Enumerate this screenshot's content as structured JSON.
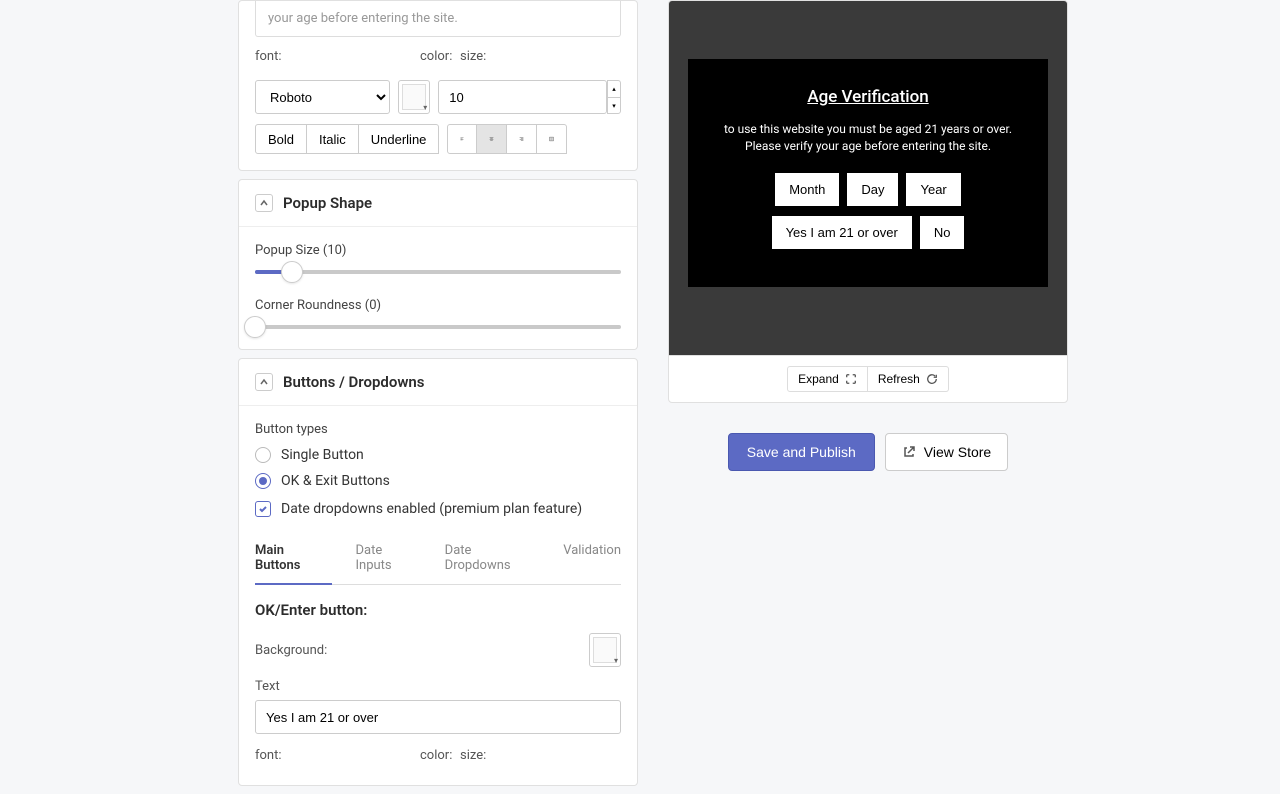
{
  "top_text_field": {
    "truncated_value": "your age before entering the site.",
    "font_label": "font:",
    "color_label": "color:",
    "size_label": "size:",
    "font_value": "Roboto",
    "size_value": "10",
    "bold": "Bold",
    "italic": "Italic",
    "underline": "Underline"
  },
  "shape": {
    "title": "Popup Shape",
    "size_label": "Popup Size (10)",
    "size_value": 10,
    "roundness_label": "Corner Roundness (0)",
    "roundness_value": 0
  },
  "buttons_panel": {
    "title": "Buttons / Dropdowns",
    "types_label": "Button types",
    "radio_single": "Single Button",
    "radio_okexit": "OK & Exit Buttons",
    "date_checkbox": "Date dropdowns enabled (premium plan feature)",
    "tabs": {
      "main": "Main Buttons",
      "date_inputs": "Date Inputs",
      "date_dropdowns": "Date Dropdowns",
      "validation": "Validation"
    },
    "ok_section": {
      "heading": "OK/Enter button:",
      "bg_label": "Background:",
      "text_label": "Text",
      "text_value": "Yes I am 21 or over",
      "font_label": "font:",
      "color_label": "color:",
      "size_label": "size:"
    }
  },
  "preview": {
    "title": "Age Verification",
    "body": "to use this website you must be aged 21 years or over. Please verify your age before entering the site.",
    "month": "Month",
    "day": "Day",
    "year": "Year",
    "yes_btn": "Yes I am 21 or over",
    "no_btn": "No",
    "expand": "Expand",
    "refresh": "Refresh"
  },
  "actions": {
    "save": "Save and Publish",
    "view_store": "View Store"
  }
}
